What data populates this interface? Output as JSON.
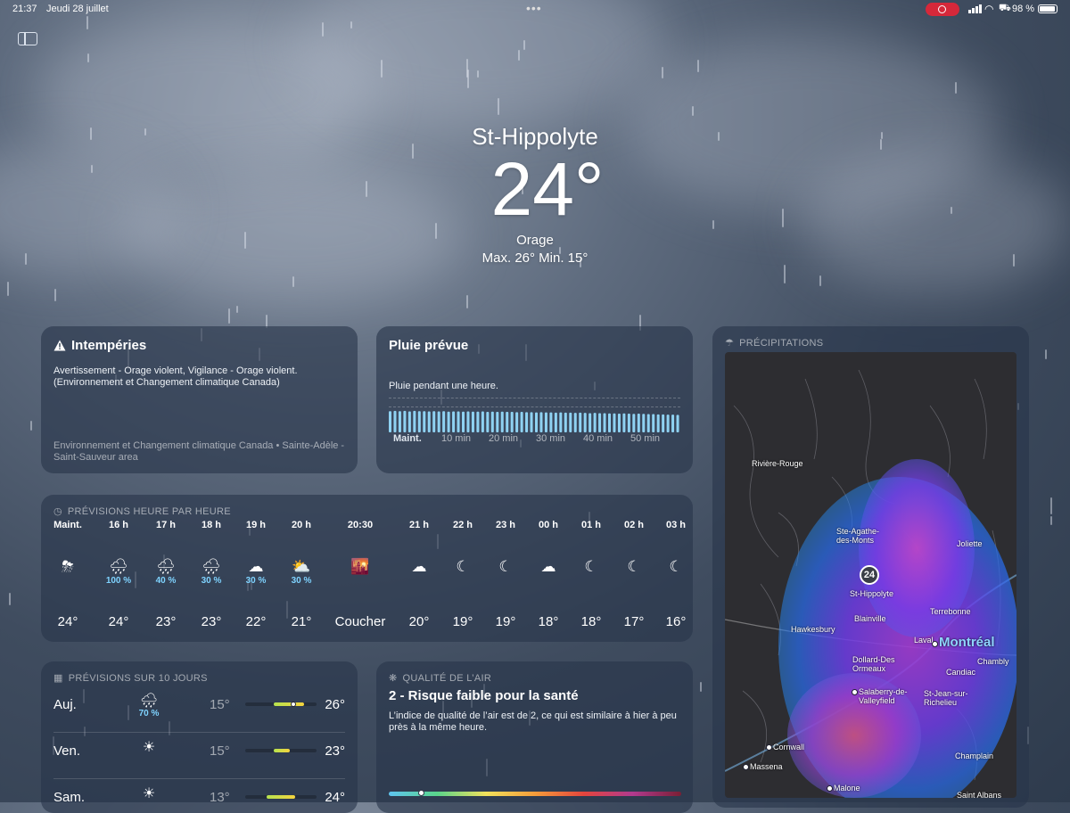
{
  "status_bar": {
    "time": "21:37",
    "date": "Jeudi 28 juillet",
    "battery_text": "98 %",
    "battery_level": 0.98,
    "icons": [
      "screen-record-icon",
      "cellular-signal-icon",
      "wifi-icon",
      "car-icon",
      "battery-icon"
    ]
  },
  "toolbar": {
    "sidebar_icon": "sidebar-toggle-icon"
  },
  "current": {
    "city": "St-Hippolyte",
    "temperature": "24°",
    "condition": "Orage",
    "range": "Max. 26°  Min. 15°"
  },
  "alert": {
    "icon": "warning-triangle-icon",
    "title": "Intempéries",
    "body": "Avertissement - Orage violent, Vigilance - Orage violent. (Environnement et Changement climatique Canada)",
    "source": "Environnement et Changement climatique Canada • Sainte-Adèle - Saint-Sauveur area"
  },
  "rain_forecast": {
    "title": "Pluie prévue",
    "subtitle": "Pluie pendant une heure.",
    "ticks": [
      "Maint.",
      "10 min",
      "20 min",
      "30 min",
      "40 min",
      "50 min"
    ],
    "intensity": [
      0.85,
      0.86,
      0.85,
      0.86,
      0.84,
      0.86,
      0.85,
      0.85,
      0.84,
      0.85,
      0.84,
      0.85,
      0.83,
      0.84,
      0.84,
      0.83,
      0.84,
      0.83,
      0.83,
      0.84,
      0.82,
      0.83,
      0.82,
      0.83,
      0.82,
      0.82,
      0.81,
      0.82,
      0.81,
      0.81,
      0.8,
      0.81,
      0.8,
      0.8,
      0.79,
      0.8,
      0.79,
      0.79,
      0.78,
      0.79,
      0.78,
      0.77,
      0.78,
      0.77,
      0.77,
      0.76,
      0.76,
      0.75,
      0.76,
      0.75,
      0.74,
      0.75,
      0.74,
      0.73,
      0.73,
      0.72,
      0.72,
      0.71,
      0.71,
      0.7
    ]
  },
  "precipitation": {
    "heading": "PRÉCIPITATIONS",
    "icon": "umbrella-icon",
    "location_badge": "24",
    "places": [
      {
        "name": "Rivière-Rouge",
        "dot": false,
        "big": false
      },
      {
        "name": "Ste-Agathe-\ndes-Monts",
        "dot": false,
        "big": false
      },
      {
        "name": "Joliette",
        "dot": false,
        "big": false
      },
      {
        "name": "St-Hippolyte",
        "dot": false,
        "big": false
      },
      {
        "name": "Hawkesbury",
        "dot": false,
        "big": false
      },
      {
        "name": "Blainville",
        "dot": false,
        "big": false
      },
      {
        "name": "Terrebonne",
        "dot": false,
        "big": false
      },
      {
        "name": "Laval",
        "dot": false,
        "big": false
      },
      {
        "name": "Montréal",
        "dot": true,
        "big": true
      },
      {
        "name": "Dollard-Des\nOrmeaux",
        "dot": false,
        "big": false
      },
      {
        "name": "Candiac",
        "dot": false,
        "big": false
      },
      {
        "name": "Chambly",
        "dot": false,
        "big": false
      },
      {
        "name": "Salaberry-de-\nValleyfield",
        "dot": true,
        "big": false
      },
      {
        "name": "St-Jean-sur-\nRichelieu",
        "dot": false,
        "big": false
      },
      {
        "name": "Cornwall",
        "dot": true,
        "big": false
      },
      {
        "name": "Massena",
        "dot": true,
        "big": false
      },
      {
        "name": "Champlain",
        "dot": false,
        "big": false
      },
      {
        "name": "Malone",
        "dot": true,
        "big": false
      },
      {
        "name": "Saint Albans",
        "dot": false,
        "big": false
      }
    ]
  },
  "hourly": {
    "heading": "PRÉVISIONS HEURE PAR HEURE",
    "icon": "clock-icon",
    "hours": [
      {
        "label": "Maint.",
        "icon": "thunderstorm-icon",
        "glyph": "⛈",
        "pct": "",
        "temp": "24°"
      },
      {
        "label": "16 h",
        "icon": "rain-icon",
        "glyph": "🌧",
        "pct": "100 %",
        "temp": "24°"
      },
      {
        "label": "17 h",
        "icon": "rain-icon",
        "glyph": "🌧",
        "pct": "40 %",
        "temp": "23°"
      },
      {
        "label": "18 h",
        "icon": "rain-icon",
        "glyph": "🌧",
        "pct": "30 %",
        "temp": "23°"
      },
      {
        "label": "19 h",
        "icon": "cloud-icon",
        "glyph": "☁",
        "pct": "30 %",
        "temp": "22°"
      },
      {
        "label": "20 h",
        "icon": "sun-cloud-icon",
        "glyph": "⛅",
        "pct": "30 %",
        "temp": "21°"
      },
      {
        "label": "20:30",
        "icon": "sunset-icon",
        "glyph": "🌇",
        "pct": "",
        "temp": "Coucher"
      },
      {
        "label": "21 h",
        "icon": "moon-cloud-icon",
        "glyph": "☁",
        "pct": "",
        "temp": "20°"
      },
      {
        "label": "22 h",
        "icon": "moon-stars-icon",
        "glyph": "☾",
        "pct": "",
        "temp": "19°"
      },
      {
        "label": "23 h",
        "icon": "moon-stars-icon",
        "glyph": "☾",
        "pct": "",
        "temp": "19°"
      },
      {
        "label": "00 h",
        "icon": "moon-cloud-icon",
        "glyph": "☁",
        "pct": "",
        "temp": "18°"
      },
      {
        "label": "01 h",
        "icon": "moon-stars-icon",
        "glyph": "☾",
        "pct": "",
        "temp": "18°"
      },
      {
        "label": "02 h",
        "icon": "moon-stars-icon",
        "glyph": "☾",
        "pct": "",
        "temp": "17°"
      },
      {
        "label": "03 h",
        "icon": "moon-stars-icon",
        "glyph": "☾",
        "pct": "",
        "temp": "16°"
      }
    ]
  },
  "daily": {
    "heading": "PRÉVISIONS SUR 10 JOURS",
    "icon": "calendar-icon",
    "days": [
      {
        "day": "Auj.",
        "icon": "rain-icon",
        "glyph": "🌧",
        "pct": "70 %",
        "low": "15°",
        "high": "26°",
        "bar_start": 0.4,
        "bar_end": 0.82,
        "current": 0.64
      },
      {
        "day": "Ven.",
        "icon": "sun-icon",
        "glyph": "☀",
        "pct": "",
        "low": "15°",
        "high": "23°",
        "bar_start": 0.4,
        "bar_end": 0.62,
        "current": null
      },
      {
        "day": "Sam.",
        "icon": "sun-icon",
        "glyph": "☀",
        "pct": "",
        "low": "13°",
        "high": "24°",
        "bar_start": 0.3,
        "bar_end": 0.7,
        "current": null
      }
    ]
  },
  "air_quality": {
    "heading": "QUALITÉ DE L’AIR",
    "icon": "air-quality-icon",
    "title": "2 - Risque faible pour la santé",
    "body": "L’indice de qualité de l’air est de 2, ce qui est similaire à hier à peu près à la même heure.",
    "level": 0.1
  },
  "colors": {
    "accent_blue": "#7fd3ff",
    "record_red": "#d6283a",
    "card_bg": "rgba(40,54,74,0.62)"
  }
}
